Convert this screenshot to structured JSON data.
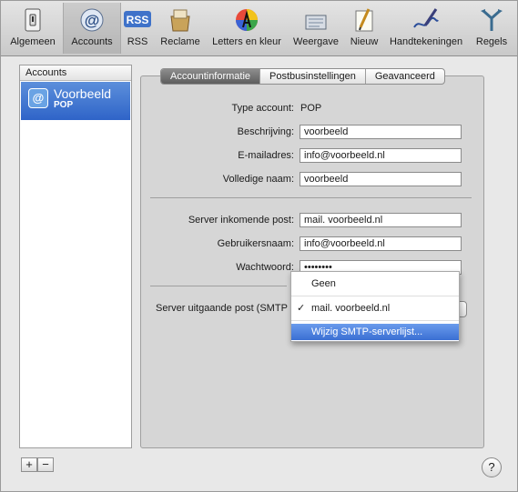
{
  "toolbar": {
    "items": [
      {
        "label": "Algemeen",
        "icon": "switch-icon"
      },
      {
        "label": "Accounts",
        "icon": "at-sign-icon"
      },
      {
        "label": "RSS",
        "icon": "rss-icon"
      },
      {
        "label": "Reclame",
        "icon": "junk-mail-icon"
      },
      {
        "label": "Letters en kleur",
        "icon": "fonts-colors-icon"
      },
      {
        "label": "Weergave",
        "icon": "viewing-icon"
      },
      {
        "label": "Nieuw",
        "icon": "composing-icon"
      },
      {
        "label": "Handtekeningen",
        "icon": "signatures-icon"
      },
      {
        "label": "Regels",
        "icon": "rules-icon"
      }
    ],
    "selected": "Accounts",
    "icon_glyphs": {
      "at": "@",
      "rss": "RSS"
    }
  },
  "accounts": {
    "header": "Accounts",
    "items": [
      {
        "name": "Voorbeeld",
        "type": "POP",
        "icon_glyph": "@"
      }
    ],
    "add_label": "+",
    "remove_label": "−"
  },
  "tabs": [
    "Accountinformatie",
    "Postbusinstellingen",
    "Geavanceerd"
  ],
  "active_tab": "Accountinformatie",
  "form": {
    "type_label": "Type account:",
    "type_value": "POP",
    "description_label": "Beschrijving:",
    "description_value": "voorbeeld",
    "email_label": "E-mailadres:",
    "email_value": "info@voorbeeld.nl",
    "fullname_label": "Volledige naam:",
    "fullname_value": "voorbeeld",
    "incoming_label": "Server inkomende post:",
    "incoming_value": "mail. voorbeeld.nl",
    "username_label": "Gebruikersnaam:",
    "username_value": "info@voorbeeld.nl",
    "password_label": "Wachtwoord:",
    "password_value": "••••••••",
    "outgoing_label": "Server uitgaande post (SMTP"
  },
  "smtp_menu": {
    "items": [
      {
        "label": "Geen",
        "checked": false
      },
      {
        "label": "mail. voorbeeld.nl",
        "checked": true
      },
      {
        "label": "Wijzig SMTP-serverlijst...",
        "highlighted": true
      }
    ],
    "check_glyph": "✓"
  },
  "help_label": "?",
  "colors": {
    "selection": "#3a6fd3",
    "list_selection": "#2f64c8"
  }
}
